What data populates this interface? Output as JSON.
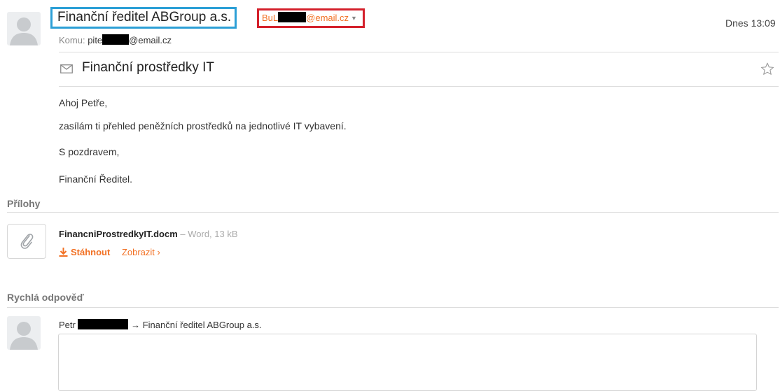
{
  "header": {
    "sender_name": "Finanční ředitel ABGroup a.s.",
    "sender_email_prefix": "BuL",
    "sender_email_domain": "@email.cz",
    "to_label": "Komu:",
    "to_prefix": "pite",
    "to_domain": "@email.cz",
    "time": "Dnes 13:09"
  },
  "subject": "Finanční prostředky IT",
  "body": {
    "greeting": "Ahoj Petře,",
    "line1": "zasílám ti přehled peněžních prostředků na jednotlivé IT vybavení.",
    "closing": "S pozdravem,",
    "signature": "Finanční Ředitel."
  },
  "attachments": {
    "title": "Přílohy",
    "items": [
      {
        "name": "FinancniProstredkyIT.docm",
        "meta": " – Word, 13 kB",
        "download_label": "Stáhnout",
        "view_label": "Zobrazit ›"
      }
    ]
  },
  "quick_reply": {
    "title": "Rychlá odpověď",
    "from_name": "Petr",
    "to_text": "→ Finanční ředitel ABGroup a.s."
  },
  "colors": {
    "accent": "#f27023",
    "sender_highlight": "#2c9fd6",
    "address_highlight": "#d4202b"
  },
  "icons": [
    "avatar-placeholder-icon",
    "envelope-icon",
    "star-icon",
    "paperclip-icon",
    "download-arrow-icon"
  ]
}
